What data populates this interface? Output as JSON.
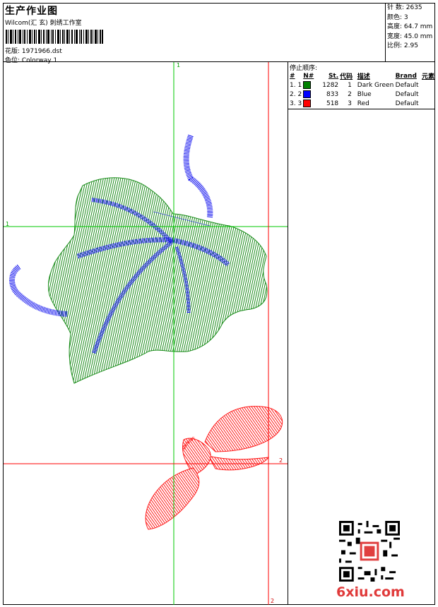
{
  "header": {
    "title": "生产作业图",
    "company": "Wilcom(汇 玄) 刺绣工作室",
    "design_label": "花版: 1971966.dst",
    "colorway_label": "色位: Colorway 1"
  },
  "stats": {
    "stitches": "针 数: 2635",
    "colors": "颜色: 3",
    "height": "高度: 64.7 mm",
    "width": "宽度: 45.0 mm",
    "scale": "比例: 2.95"
  },
  "sequence": {
    "title": "停止顺序:",
    "headers": [
      "#",
      "N#",
      "St.",
      "代码",
      "描述",
      "Brand",
      "元素"
    ],
    "rows": [
      {
        "idx": "1. 1",
        "color": "#008000",
        "stitches": "1282",
        "code": "1",
        "desc": "Dark Green",
        "brand": "Default"
      },
      {
        "idx": "2. 2",
        "color": "#0000ff",
        "stitches": "833",
        "code": "2",
        "desc": "Blue",
        "brand": "Default"
      },
      {
        "idx": "3. 3",
        "color": "#ff0000",
        "stitches": "518",
        "code": "3",
        "desc": "Red",
        "brand": "Default"
      }
    ]
  },
  "guides": {
    "green_label": "1",
    "red_label": "2",
    "green_color": "#00c800",
    "red_color": "#ff0000"
  },
  "watermark": "6xiu.com"
}
